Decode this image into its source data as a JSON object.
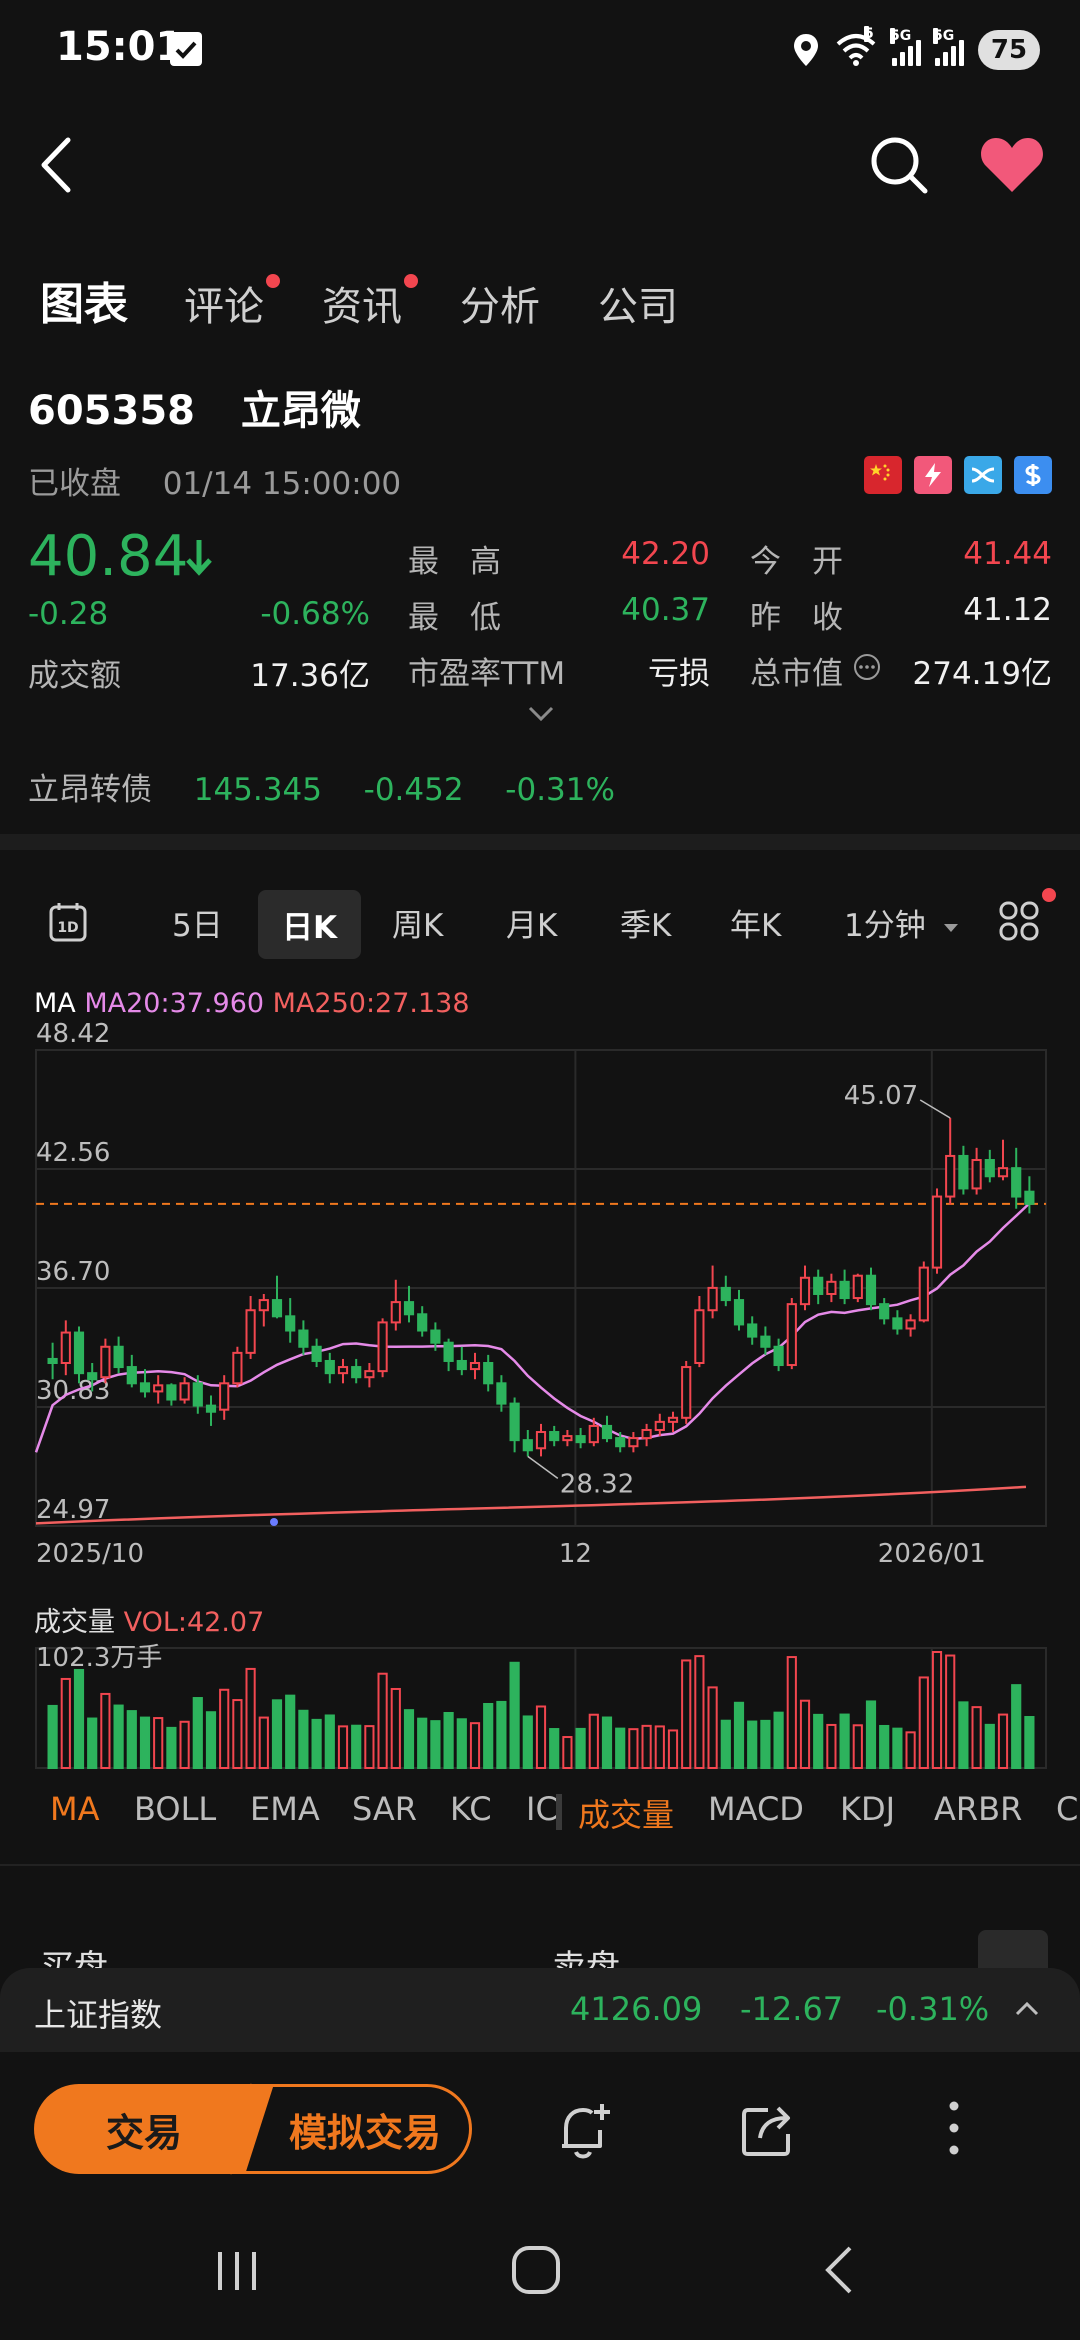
{
  "status_bar": {
    "time": "15:01",
    "signal_tags": [
      "5",
      "5G",
      "5G"
    ],
    "battery": "75"
  },
  "tabs": [
    {
      "label": "图表",
      "active": true,
      "dot": false
    },
    {
      "label": "评论",
      "active": false,
      "dot": true
    },
    {
      "label": "资讯",
      "active": false,
      "dot": true
    },
    {
      "label": "分析",
      "active": false,
      "dot": false
    },
    {
      "label": "公司",
      "active": false,
      "dot": false
    }
  ],
  "stock": {
    "code": "605358",
    "name": "立昂微",
    "status": "已收盘",
    "datetime": "01/14 15:00:00",
    "price": "40.84",
    "change": "-0.28",
    "change_pct": "-0.68%",
    "turnover_label": "成交额",
    "turnover": "17.36亿"
  },
  "quote": {
    "high_label": "最　高",
    "high": "42.20",
    "low_label": "最　低",
    "low": "40.37",
    "pe_label": "市盈率TTM",
    "pe": "亏损",
    "open_label": "今　开",
    "open": "41.44",
    "prev_close_label": "昨　收",
    "prev_close": "41.12",
    "mcap_label": "总市值",
    "mcap": "274.19亿"
  },
  "flags": [
    {
      "icon": "china-flag-icon",
      "color": "#d8262d"
    },
    {
      "icon": "margin-icon",
      "color": "#f2587a"
    },
    {
      "icon": "connect-icon",
      "color": "#3aa8e8"
    },
    {
      "icon": "dollar-icon",
      "color": "#3c8ef0"
    }
  ],
  "bond": {
    "name": "立昂转债",
    "price": "145.345",
    "change": "-0.452",
    "change_pct": "-0.31%"
  },
  "timeframes": [
    {
      "label": "5日",
      "active": false
    },
    {
      "label": "日K",
      "active": true
    },
    {
      "label": "周K",
      "active": false
    },
    {
      "label": "月K",
      "active": false
    },
    {
      "label": "季K",
      "active": false
    },
    {
      "label": "年K",
      "active": false
    },
    {
      "label": "1分钟",
      "active": false
    }
  ],
  "day_icon_label": "1D",
  "ma": {
    "label": "MA",
    "ma20": "MA20:37.960",
    "ma250": "MA250:27.138"
  },
  "chart_data": {
    "type": "candlestick",
    "y_ticks": [
      "48.42",
      "42.56",
      "36.70",
      "30.83",
      "24.97"
    ],
    "ylim": [
      24.97,
      48.42
    ],
    "x_ticks": [
      "2025/10",
      "12",
      "2026/01"
    ],
    "max_label": "45.07",
    "min_label": "28.32",
    "last_close_line": 40.84,
    "ma_colors": {
      "ma20": "#e58ae8",
      "ma250": "#f2605f"
    },
    "candles": [
      [
        33.2,
        34.0,
        32.2,
        33.0
      ],
      [
        33.0,
        35.1,
        32.4,
        34.5
      ],
      [
        34.5,
        34.8,
        32.0,
        32.5
      ],
      [
        32.5,
        33.0,
        31.6,
        32.2
      ],
      [
        32.3,
        34.2,
        32.0,
        33.8
      ],
      [
        33.8,
        34.3,
        32.5,
        32.8
      ],
      [
        32.8,
        33.4,
        31.8,
        32.0
      ],
      [
        32.0,
        32.7,
        31.3,
        31.6
      ],
      [
        31.6,
        32.4,
        31.0,
        31.9
      ],
      [
        31.9,
        32.0,
        30.9,
        31.2
      ],
      [
        31.2,
        32.3,
        31.0,
        32.0
      ],
      [
        32.0,
        32.4,
        30.5,
        30.9
      ],
      [
        30.9,
        31.4,
        29.9,
        30.6
      ],
      [
        30.7,
        32.4,
        30.2,
        32.0
      ],
      [
        32.0,
        33.8,
        31.8,
        33.5
      ],
      [
        33.5,
        36.3,
        33.2,
        35.6
      ],
      [
        35.6,
        36.4,
        34.8,
        36.1
      ],
      [
        36.1,
        37.3,
        35.2,
        35.3
      ],
      [
        35.3,
        36.2,
        34.0,
        34.6
      ],
      [
        34.6,
        35.1,
        33.4,
        33.8
      ],
      [
        33.8,
        34.2,
        32.8,
        33.1
      ],
      [
        33.1,
        33.5,
        32.0,
        32.5
      ],
      [
        32.5,
        33.2,
        32.0,
        32.8
      ],
      [
        32.8,
        33.2,
        32.0,
        32.3
      ],
      [
        32.3,
        33.0,
        31.8,
        32.6
      ],
      [
        32.6,
        35.2,
        32.3,
        35.0
      ],
      [
        35.0,
        37.1,
        34.6,
        36.0
      ],
      [
        36.0,
        36.8,
        35.0,
        35.4
      ],
      [
        35.4,
        35.8,
        34.3,
        34.6
      ],
      [
        34.6,
        35.0,
        33.6,
        34.0
      ],
      [
        34.0,
        34.2,
        32.6,
        33.1
      ],
      [
        33.1,
        33.8,
        32.4,
        32.7
      ],
      [
        32.7,
        33.5,
        32.2,
        33.0
      ],
      [
        33.0,
        33.4,
        31.6,
        32.0
      ],
      [
        32.0,
        32.4,
        30.6,
        31.0
      ],
      [
        31.0,
        31.3,
        28.6,
        29.2
      ],
      [
        29.2,
        29.7,
        28.4,
        28.7
      ],
      [
        28.8,
        30.0,
        28.4,
        29.6
      ],
      [
        29.6,
        29.9,
        28.9,
        29.2
      ],
      [
        29.2,
        29.7,
        28.9,
        29.4
      ],
      [
        29.4,
        29.8,
        28.8,
        29.1
      ],
      [
        29.1,
        30.3,
        28.9,
        29.9
      ],
      [
        29.9,
        30.4,
        29.1,
        29.3
      ],
      [
        29.3,
        29.6,
        28.6,
        28.9
      ],
      [
        28.9,
        29.6,
        28.6,
        29.3
      ],
      [
        29.3,
        30.0,
        28.9,
        29.7
      ],
      [
        29.7,
        30.5,
        29.4,
        30.1
      ],
      [
        30.1,
        30.6,
        29.6,
        30.3
      ],
      [
        30.3,
        33.1,
        30.0,
        32.8
      ],
      [
        33.0,
        36.3,
        32.8,
        35.6
      ],
      [
        35.6,
        37.8,
        35.2,
        36.7
      ],
      [
        36.7,
        37.3,
        35.8,
        36.1
      ],
      [
        36.1,
        36.6,
        34.6,
        34.9
      ],
      [
        34.9,
        35.3,
        33.9,
        34.3
      ],
      [
        34.3,
        34.8,
        33.4,
        33.8
      ],
      [
        33.8,
        34.2,
        32.6,
        32.9
      ],
      [
        32.9,
        36.2,
        32.7,
        35.9
      ],
      [
        35.9,
        37.8,
        35.6,
        37.2
      ],
      [
        37.2,
        37.6,
        35.9,
        36.4
      ],
      [
        36.4,
        37.4,
        36.0,
        37.0
      ],
      [
        37.0,
        37.6,
        35.9,
        36.2
      ],
      [
        36.2,
        37.4,
        36.0,
        37.3
      ],
      [
        37.3,
        37.7,
        35.6,
        35.9
      ],
      [
        35.9,
        36.2,
        34.9,
        35.2
      ],
      [
        35.2,
        35.6,
        34.4,
        34.7
      ],
      [
        34.7,
        35.4,
        34.3,
        35.1
      ],
      [
        35.1,
        38.0,
        35.0,
        37.7
      ],
      [
        37.7,
        41.6,
        37.4,
        41.2
      ],
      [
        41.2,
        45.07,
        40.8,
        43.2
      ],
      [
        43.2,
        43.7,
        41.3,
        41.6
      ],
      [
        41.6,
        43.6,
        41.3,
        43.0
      ],
      [
        43.0,
        43.5,
        41.9,
        42.2
      ],
      [
        42.2,
        44.0,
        42.0,
        42.6
      ],
      [
        42.6,
        43.6,
        40.6,
        41.2
      ],
      [
        41.44,
        42.2,
        40.37,
        40.84
      ]
    ],
    "volume_max_label": "102.3万手",
    "volume_label": "成交量",
    "volume_value": "VOL:42.07"
  },
  "indicators": [
    {
      "label": "MA",
      "active": true
    },
    {
      "label": "BOLL",
      "active": false
    },
    {
      "label": "EMA",
      "active": false
    },
    {
      "label": "SAR",
      "active": false
    },
    {
      "label": "KC",
      "active": false
    },
    {
      "label": "IC",
      "active": false
    },
    {
      "label": "成交量",
      "active": true
    },
    {
      "label": "MACD",
      "active": false
    },
    {
      "label": "KDJ",
      "active": false
    },
    {
      "label": "ARBR",
      "active": false
    },
    {
      "label": "C",
      "active": false
    }
  ],
  "book": {
    "buy": "买盘",
    "sell": "卖盘"
  },
  "index_bar": {
    "name": "上证指数",
    "value": "4126.09",
    "change": "-12.67",
    "change_pct": "-0.31%"
  },
  "actions": {
    "trade": "交易",
    "sim_trade": "模拟交易"
  }
}
